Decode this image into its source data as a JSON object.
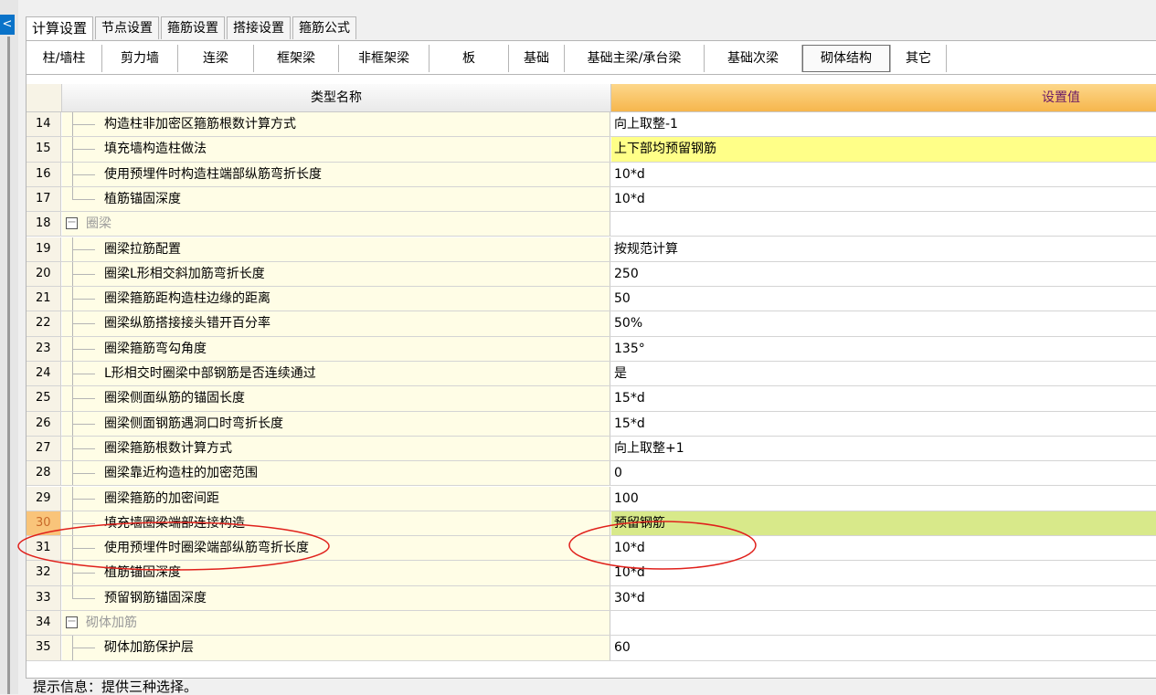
{
  "sidebar": {
    "collapse_glyph": "<"
  },
  "tabs_top": [
    "计算设置",
    "节点设置",
    "箍筋设置",
    "搭接设置",
    "箍筋公式"
  ],
  "tabs_top_active": 0,
  "tabs_sub": [
    "柱/墙柱",
    "剪力墙",
    "连梁",
    "框架梁",
    "非框架梁",
    "板",
    "基础",
    "基础主梁/承台梁",
    "基础次梁",
    "砌体结构",
    "其它"
  ],
  "tabs_sub_active": 9,
  "table": {
    "header_name": "类型名称",
    "header_value": "设置值",
    "rows": [
      {
        "num": "14",
        "name": "构造柱非加密区箍筋根数计算方式",
        "value": "向上取整-1",
        "type": "item"
      },
      {
        "num": "15",
        "name": "填充墙构造柱做法",
        "value": "上下部均预留钢筋",
        "type": "item",
        "highlight": "yellow"
      },
      {
        "num": "16",
        "name": "使用预埋件时构造柱端部纵筋弯折长度",
        "value": "10*d",
        "type": "item"
      },
      {
        "num": "17",
        "name": "植筋锚固深度",
        "value": "10*d",
        "type": "item-last"
      },
      {
        "num": "18",
        "name": "圈梁",
        "value": "",
        "type": "group"
      },
      {
        "num": "19",
        "name": "圈梁拉筋配置",
        "value": "按规范计算",
        "type": "item"
      },
      {
        "num": "20",
        "name": "圈梁L形相交斜加筋弯折长度",
        "value": "250",
        "type": "item"
      },
      {
        "num": "21",
        "name": "圈梁箍筋距构造柱边缘的距离",
        "value": "50",
        "type": "item"
      },
      {
        "num": "22",
        "name": "圈梁纵筋搭接接头错开百分率",
        "value": "50%",
        "type": "item"
      },
      {
        "num": "23",
        "name": "圈梁箍筋弯勾角度",
        "value": "135°",
        "type": "item"
      },
      {
        "num": "24",
        "name": "L形相交时圈梁中部钢筋是否连续通过",
        "value": "是",
        "type": "item"
      },
      {
        "num": "25",
        "name": "圈梁侧面纵筋的锚固长度",
        "value": "15*d",
        "type": "item"
      },
      {
        "num": "26",
        "name": "圈梁侧面钢筋遇洞口时弯折长度",
        "value": "15*d",
        "type": "item"
      },
      {
        "num": "27",
        "name": "圈梁箍筋根数计算方式",
        "value": "向上取整+1",
        "type": "item"
      },
      {
        "num": "28",
        "name": "圈梁靠近构造柱的加密范围",
        "value": "0",
        "type": "item"
      },
      {
        "num": "29",
        "name": "圈梁箍筋的加密间距",
        "value": "100",
        "type": "item"
      },
      {
        "num": "30",
        "name": "填充墙圈梁端部连接构造",
        "value": "预留钢筋",
        "type": "item",
        "highlight": "selected"
      },
      {
        "num": "31",
        "name": "使用预埋件时圈梁端部纵筋弯折长度",
        "value": "10*d",
        "type": "item"
      },
      {
        "num": "32",
        "name": "植筋锚固深度",
        "value": "10*d",
        "type": "item"
      },
      {
        "num": "33",
        "name": "预留钢筋锚固深度",
        "value": "30*d",
        "type": "item-last"
      },
      {
        "num": "34",
        "name": "砌体加筋",
        "value": "",
        "type": "group"
      },
      {
        "num": "35",
        "name": "砌体加筋保护层",
        "value": "60",
        "type": "item"
      }
    ]
  },
  "hint": "提示信息：提供三种选择。",
  "colors": {
    "header_value_bg": "#f6b64d",
    "header_value_text": "#6b1a66",
    "row_highlight_yellow": "#ffff88",
    "row_selected_value": "#d8e98a",
    "annotation_circle": "#e0201b"
  }
}
